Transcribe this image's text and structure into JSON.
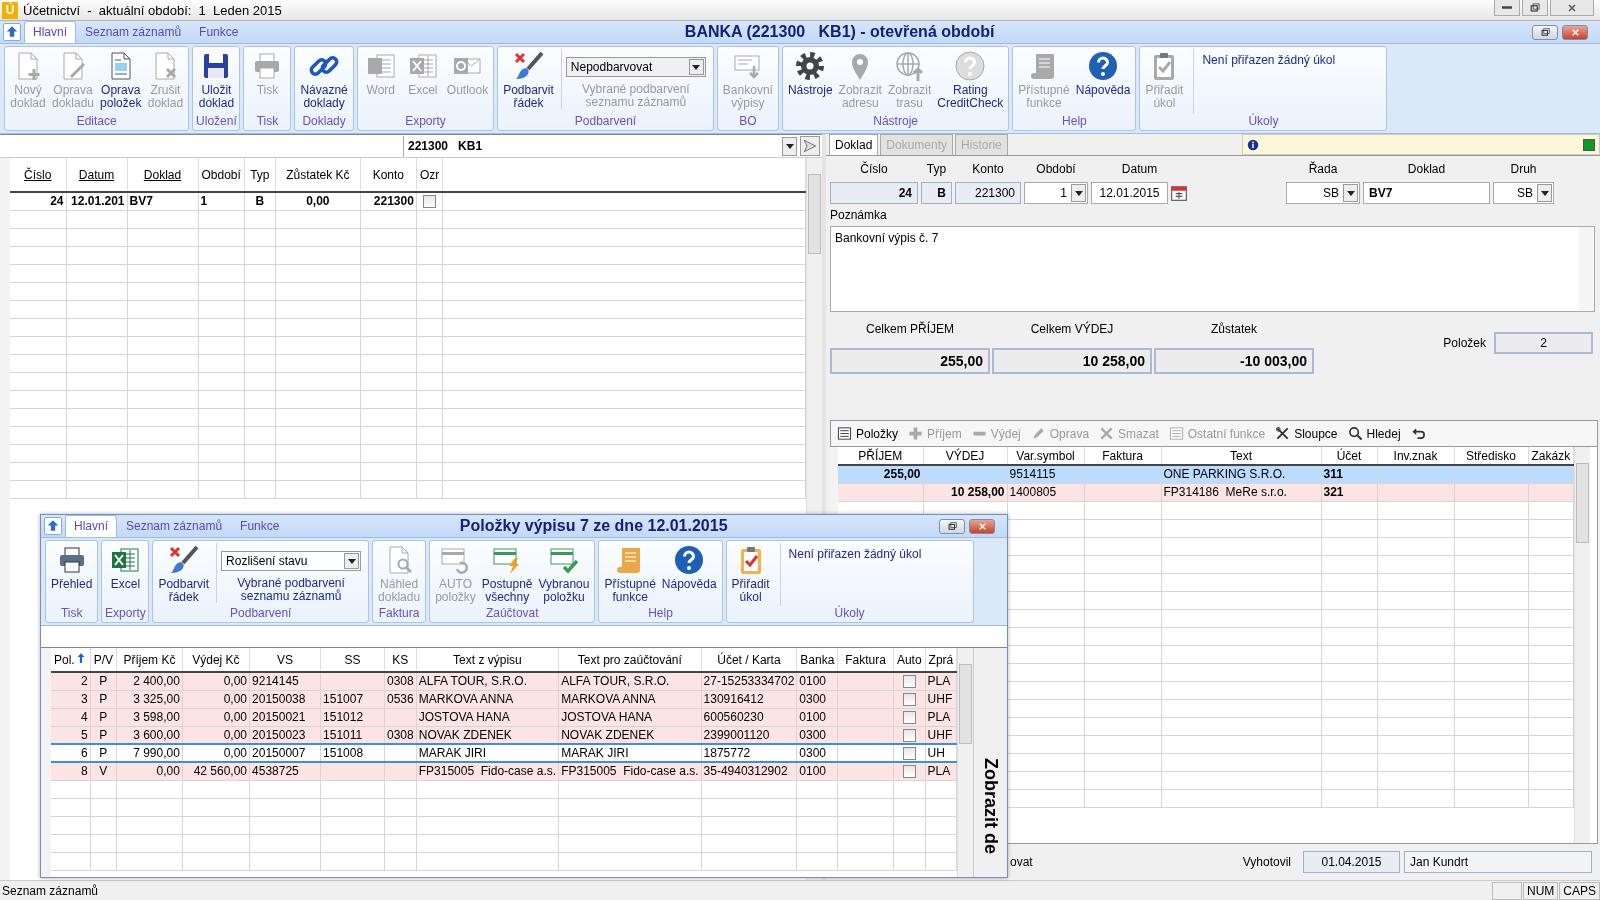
{
  "app": {
    "icon_letter": "Ú",
    "title": "Účetnictví  -  aktuální období:  1  Leden 2015"
  },
  "main_window": {
    "tabs": [
      {
        "label": "Hlavní",
        "selected": true
      },
      {
        "label": "Seznam záznamů",
        "selected": false
      },
      {
        "label": "Funkce",
        "selected": false
      }
    ],
    "title": "BANKA (221300   KB1) - otevřená období",
    "ribbon": [
      {
        "label": "Editace",
        "items": [
          {
            "kind": "button",
            "label": "Nový\ndoklad",
            "disabled": true
          },
          {
            "kind": "button",
            "label": "Oprava\ndokladu",
            "disabled": true
          },
          {
            "kind": "button",
            "label": "Oprava\npoložek",
            "disabled": false
          },
          {
            "kind": "button",
            "label": "Zrušit\ndoklad",
            "disabled": true
          }
        ]
      },
      {
        "label": "Uložení",
        "items": [
          {
            "kind": "button",
            "label": "Uložit\ndoklad",
            "disabled": false
          }
        ]
      },
      {
        "label": "Tisk",
        "items": [
          {
            "kind": "button",
            "label": "Tisk",
            "disabled": true
          }
        ]
      },
      {
        "label": "Doklady",
        "items": [
          {
            "kind": "button",
            "label": "Návazné\ndoklady",
            "disabled": false
          }
        ]
      },
      {
        "label": "Exporty",
        "items": [
          {
            "kind": "button",
            "label": "Word",
            "disabled": true
          },
          {
            "kind": "button",
            "label": "Excel",
            "disabled": true
          },
          {
            "kind": "button",
            "label": "Outlook",
            "disabled": true
          }
        ]
      },
      {
        "label": "Podbarvení",
        "items": [
          {
            "kind": "button",
            "label": "Podbarvit\nřádek",
            "disabled": false
          },
          {
            "kind": "combo",
            "value": "Nepodbarvovat",
            "caption": "Vybrané podbarvení\nseznamu záznamů",
            "disabled": true
          }
        ]
      },
      {
        "label": "BO",
        "items": [
          {
            "kind": "button",
            "label": "Bankovní\nvýpisy",
            "disabled": true
          }
        ]
      },
      {
        "label": "Nástroje",
        "items": [
          {
            "kind": "button",
            "label": "Nástroje",
            "disabled": false
          },
          {
            "kind": "button",
            "label": "Zobrazit\nadresu",
            "disabled": true
          },
          {
            "kind": "button",
            "label": "Zobrazit\ntrasu",
            "disabled": true
          },
          {
            "kind": "button",
            "label": "Rating\nCreditCheck",
            "disabled": false
          }
        ]
      },
      {
        "label": "Help",
        "items": [
          {
            "kind": "button",
            "label": "Přístupné\nfunkce",
            "disabled": true
          },
          {
            "kind": "button",
            "label": "Nápověda",
            "disabled": false
          }
        ]
      },
      {
        "label": "Úkoly",
        "items": [
          {
            "kind": "button",
            "label": "Přiřadit\núkol",
            "disabled": true
          },
          {
            "kind": "task",
            "text": "Není přiřazen žádný úkol"
          }
        ]
      }
    ]
  },
  "list_panel": {
    "account_combo": "221300   KB1",
    "columns": [
      {
        "label": "Číslo",
        "sortable": true,
        "kind": "text"
      },
      {
        "label": "Datum",
        "sortable": true,
        "kind": "text"
      },
      {
        "label": "Doklad",
        "sortable": true,
        "kind": "text"
      },
      {
        "label": "Období",
        "sortable": false,
        "kind": "text"
      },
      {
        "label": "Typ",
        "sortable": false,
        "kind": "text"
      },
      {
        "label": "Zůstatek Kč",
        "sortable": false,
        "kind": "text"
      },
      {
        "label": "Konto",
        "sortable": false,
        "kind": "text"
      },
      {
        "label": "Ozr",
        "sortable": false,
        "kind": "checkbox"
      }
    ],
    "rows": [
      {
        "cells": [
          "24",
          "12.01.201",
          "BV7",
          "1",
          "B",
          "0,00",
          "221300"
        ],
        "checked": false
      }
    ]
  },
  "detail_panel": {
    "tabs": [
      {
        "label": "Doklad",
        "selected": true,
        "disabled": false
      },
      {
        "label": "Dokumenty",
        "selected": false,
        "disabled": true
      },
      {
        "label": "Historie",
        "selected": false,
        "disabled": true
      }
    ],
    "fields": [
      {
        "label": "Číslo",
        "value": "24",
        "kind": "text"
      },
      {
        "label": "Typ",
        "value": "B",
        "kind": "text"
      },
      {
        "label": "Konto",
        "value": "221300",
        "kind": "text"
      },
      {
        "label": "Období",
        "value": "1",
        "kind": "combo"
      },
      {
        "label": "Datum",
        "value": "12.01.2015",
        "kind": "date"
      },
      {
        "label": "Řada",
        "value": "SB",
        "kind": "combo"
      },
      {
        "label": "Doklad",
        "value": "BV7",
        "kind": "input"
      },
      {
        "label": "Druh",
        "value": "SB",
        "kind": "combo"
      }
    ],
    "note_label": "Poznámka",
    "note": "Bankovní výpis č. 7",
    "totals": [
      {
        "label": "Celkem PŘÍJEM",
        "value": "255,00"
      },
      {
        "label": "Celkem VÝDEJ",
        "value": "10 258,00"
      },
      {
        "label": "Zůstatek",
        "value": "-10 003,00"
      }
    ],
    "count_label": "Položek",
    "count": "2",
    "toolbar": [
      {
        "label": "Položky",
        "disabled": false
      },
      {
        "label": "Příjem",
        "disabled": true
      },
      {
        "label": "Výdej",
        "disabled": true
      },
      {
        "label": "Oprava",
        "disabled": true
      },
      {
        "label": "Smazat",
        "disabled": true
      },
      {
        "label": "Ostatní funkce",
        "disabled": true
      },
      {
        "label": "Sloupce",
        "disabled": false
      },
      {
        "label": "Hledej",
        "disabled": false
      }
    ],
    "grid": {
      "columns": [
        "PŘÍJEM",
        "VÝDEJ",
        "Var.symbol",
        "Faktura",
        "Text",
        "Účet",
        "Inv.znak",
        "Středisko",
        "Zakázk"
      ],
      "rows": [
        {
          "cells": [
            "255,00",
            null,
            "9514115",
            null,
            "ONE PARKING S.R.O.",
            "311",
            null,
            null,
            null
          ],
          "selected": true
        },
        {
          "cells": [
            null,
            "10 258,00",
            "1400805",
            null,
            "FP314186  MeRe s.r.o.",
            "321",
            null,
            null,
            null
          ],
          "selected": false
        }
      ]
    },
    "footer": {
      "cut_label": "ovat",
      "author_label": "Vyhotovil",
      "date": "01.04.2015",
      "author": "Jan Kundrt"
    }
  },
  "items_window": {
    "tabs": [
      {
        "label": "Hlavní",
        "selected": true
      },
      {
        "label": "Seznam záznamů",
        "selected": false
      },
      {
        "label": "Funkce",
        "selected": false
      }
    ],
    "title": "Položky výpisu 7 ze dne 12.01.2015",
    "ribbon": [
      {
        "label": "Tisk",
        "items": [
          {
            "kind": "button",
            "label": "Přehled",
            "disabled": false
          }
        ]
      },
      {
        "label": "Exporty",
        "items": [
          {
            "kind": "button",
            "label": "Excel",
            "disabled": false
          }
        ]
      },
      {
        "label": "Podbarvení",
        "items": [
          {
            "kind": "button",
            "label": "Podbarvit\nřádek",
            "disabled": false
          },
          {
            "kind": "combo",
            "value": "Rozlišení stavu",
            "caption": "Vybrané podbarvení\nseznamu záznamů",
            "disabled": false
          }
        ]
      },
      {
        "label": "Faktura",
        "items": [
          {
            "kind": "button",
            "label": "Náhled\ndokladu",
            "disabled": true
          }
        ]
      },
      {
        "label": "Zaúčtovat",
        "items": [
          {
            "kind": "button",
            "label": "AUTO\npoložky",
            "disabled": true
          },
          {
            "kind": "button",
            "label": "Postupně\nvšechny",
            "disabled": false
          },
          {
            "kind": "button",
            "label": "Vybranou\npoložku",
            "disabled": false
          }
        ]
      },
      {
        "label": "Help",
        "items": [
          {
            "kind": "button",
            "label": "Přístupné\nfunkce",
            "disabled": false
          },
          {
            "kind": "button",
            "label": "Nápověda",
            "disabled": false
          }
        ]
      },
      {
        "label": "Úkoly",
        "items": [
          {
            "kind": "button",
            "label": "Přiřadit\núkol",
            "disabled": false
          },
          {
            "kind": "task",
            "text": "Není přiřazen žádný úkol"
          }
        ]
      }
    ],
    "grid": {
      "columns": [
        {
          "label": "Pol.",
          "sorted": true,
          "kind": "text"
        },
        {
          "label": "P/V",
          "sorted": false,
          "kind": "text"
        },
        {
          "label": "Příjem Kč",
          "sorted": false,
          "kind": "text"
        },
        {
          "label": "Výdej Kč",
          "sorted": false,
          "kind": "text"
        },
        {
          "label": "VS",
          "sorted": false,
          "kind": "text"
        },
        {
          "label": "SS",
          "sorted": false,
          "kind": "text"
        },
        {
          "label": "KS",
          "sorted": false,
          "kind": "text"
        },
        {
          "label": "Text z výpisu",
          "sorted": false,
          "kind": "text"
        },
        {
          "label": "Text pro zaúčtování",
          "sorted": false,
          "kind": "text"
        },
        {
          "label": "Účet / Karta",
          "sorted": false,
          "kind": "text"
        },
        {
          "label": "Banka",
          "sorted": false,
          "kind": "text"
        },
        {
          "label": "Faktura",
          "sorted": false,
          "kind": "text"
        },
        {
          "label": "Auto",
          "sorted": false,
          "kind": "checkbox"
        },
        {
          "label": "Zprá",
          "sorted": false,
          "kind": "text"
        }
      ],
      "rows": [
        {
          "cells": [
            "2",
            "P",
            "2 400,00",
            "0,00",
            "9214145",
            null,
            "0308",
            "ALFA TOUR, S.R.O.",
            "ALFA TOUR, S.R.O.",
            "27-15253334702",
            "0100",
            null,
            "PLA"
          ],
          "checked": false,
          "selected": false
        },
        {
          "cells": [
            "3",
            "P",
            "3 325,00",
            "0,00",
            "20150038",
            "151007",
            "0536",
            "MARKOVA ANNA",
            "MARKOVA ANNA",
            "130916412",
            "0300",
            null,
            "UHF"
          ],
          "checked": false,
          "selected": false
        },
        {
          "cells": [
            "4",
            "P",
            "3 598,00",
            "0,00",
            "20150021",
            "151012",
            null,
            "JOSTOVA HANA",
            "JOSTOVA HANA",
            "600560230",
            "0100",
            null,
            "PLA"
          ],
          "checked": false,
          "selected": false
        },
        {
          "cells": [
            "5",
            "P",
            "3 600,00",
            "0,00",
            "20150023",
            "151011",
            "0308",
            "NOVAK ZDENEK",
            "NOVAK ZDENEK",
            "2399001120",
            "0300",
            null,
            "UHF"
          ],
          "checked": false,
          "selected": false
        },
        {
          "cells": [
            "6",
            "P",
            "7 990,00",
            "0,00",
            "20150007",
            "151008",
            null,
            "MARAK JIRI",
            "MARAK JIRI",
            "1875772",
            "0300",
            null,
            "UH"
          ],
          "checked": false,
          "selected": true
        },
        {
          "cells": [
            "8",
            "V",
            "0,00",
            "42 560,00",
            "4538725",
            null,
            null,
            "FP315005  Fido-case a.s.",
            "FP315005  Fido-case a.s.",
            "35-4940312902",
            "0100",
            null,
            "PLA"
          ],
          "checked": false,
          "selected": false
        }
      ]
    },
    "side_label": "Zobrazit de"
  },
  "status_bar": {
    "text": "Seznam záznamů",
    "indicators": [
      "NUM",
      "CAPS"
    ]
  }
}
